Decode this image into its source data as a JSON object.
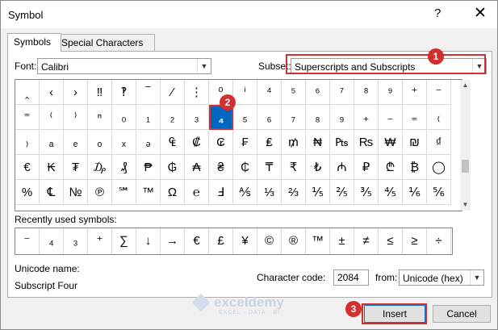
{
  "window": {
    "title": "Symbol",
    "help_label": "?",
    "close_label": "✕"
  },
  "tabs": [
    {
      "label": "Symbols",
      "active": true
    },
    {
      "label": "Special Characters",
      "active": false
    }
  ],
  "font": {
    "label": "Font:",
    "value": "Calibri"
  },
  "subset": {
    "label": "Subset:",
    "value": "Superscripts and Subscripts"
  },
  "symbol_grid": {
    "rows": [
      [
        "‸",
        "‹",
        "›",
        "‼",
        "‽",
        "‾",
        "⁄",
        "⋮",
        "⁰",
        "ⁱ",
        "⁴",
        "⁵",
        "⁶",
        "⁷",
        "⁸",
        "⁹",
        "⁺",
        "⁻"
      ],
      [
        "⁼",
        "⁽",
        "⁾",
        "ⁿ",
        "₀",
        "₁",
        "₂",
        "₃",
        "₄",
        "₅",
        "₆",
        "₇",
        "₈",
        "₉",
        "₊",
        "₋",
        "₌",
        "₍"
      ],
      [
        "₎",
        "ₐ",
        "ₑ",
        "ₒ",
        "ₓ",
        "ₔ",
        "₠",
        "₡",
        "₢",
        "₣",
        "₤",
        "₥",
        "₦",
        "₧",
        "₨",
        "₩",
        "₪",
        "₫"
      ],
      [
        "€",
        "₭",
        "₮",
        "₯",
        "₰",
        "₱",
        "₲",
        "₳",
        "₴",
        "₵",
        "₸",
        "₹",
        "₺",
        "₼",
        "₽",
        "₾",
        "₿",
        "◯"
      ],
      [
        "%",
        "℄",
        "№",
        "℗",
        "℠",
        "™",
        "Ω",
        "℮",
        "Ⅎ",
        "⅍",
        "⅓",
        "⅔",
        "⅕",
        "⅖",
        "⅗",
        "⅘",
        "⅙",
        "⅚"
      ]
    ],
    "selected_row": 1,
    "selected_col": 8
  },
  "recent": {
    "label": "Recently used symbols:",
    "items": [
      "⁻",
      "₄",
      "₃",
      "⁺",
      "∑",
      "↓",
      "→",
      "€",
      "£",
      "¥",
      "©",
      "®",
      "™",
      "±",
      "≠",
      "≤",
      "≥",
      "÷"
    ]
  },
  "unicode_name": {
    "label": "Unicode name:",
    "value": "Subscript Four"
  },
  "character_code": {
    "label": "Character code:",
    "value": "2084"
  },
  "from": {
    "label": "from:",
    "value": "Unicode (hex)"
  },
  "buttons": {
    "insert": "Insert",
    "cancel": "Cancel"
  },
  "callouts": [
    "1",
    "2",
    "3"
  ],
  "watermark": {
    "name": "exceldemy",
    "tagline": "EXCEL · DATA · BI"
  },
  "colors": {
    "highlight": "#d32f2f",
    "selected_cell": "#0067c0"
  }
}
